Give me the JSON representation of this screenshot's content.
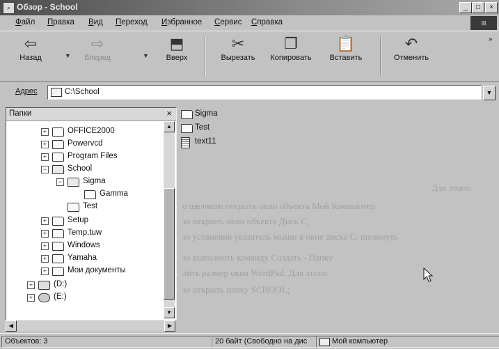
{
  "window": {
    "title": "Обзор - School"
  },
  "menu": [
    "Файл",
    "Правка",
    "Вид",
    "Переход",
    "Избранное",
    "Сервис",
    "Справка"
  ],
  "toolbar": {
    "back": "Назад",
    "forward": "Вперед",
    "up": "Вверх",
    "cut": "Вырезать",
    "copy": "Копировать",
    "paste": "Вставить",
    "undo": "Отменить"
  },
  "address": {
    "label": "Адрес",
    "value": "C:\\School"
  },
  "folders_pane": {
    "title": "Папки",
    "close": "×",
    "items": [
      {
        "label": "OFFICE2000"
      },
      {
        "label": "Powervcd"
      },
      {
        "label": "Program Files"
      },
      {
        "label": "School"
      },
      {
        "label": "Sigma"
      },
      {
        "label": "Gamma"
      },
      {
        "label": "Test"
      },
      {
        "label": "Setup"
      },
      {
        "label": "Temp.tuw"
      },
      {
        "label": "Windows"
      },
      {
        "label": "Yamaha"
      },
      {
        "label": "Мои документы"
      },
      {
        "label": "(D:)"
      },
      {
        "label": "(E:)"
      }
    ]
  },
  "files": [
    {
      "name": "Sigma",
      "icon": "folder-icon"
    },
    {
      "name": "Test",
      "icon": "folder-icon"
    },
    {
      "name": "text11",
      "icon": "document-icon"
    }
  ],
  "status": {
    "objects": "Объектов: 3",
    "size": "20 байт (Свободно на дис",
    "location": "Мой компьютер"
  },
  "bleed_text": [
    "Для этого:",
    "о щелчком открыть окно объекта Мой Компьютер",
    "зо открыть окно объекта Диск C;",
    "зо установив указатель мыши в окне диска C: щелкнуть",
    "зо выполнить команду Создать - Папку",
    "лить размер окна WordPad. Для этого:",
    "зо открыть папку SCHOOL;"
  ]
}
